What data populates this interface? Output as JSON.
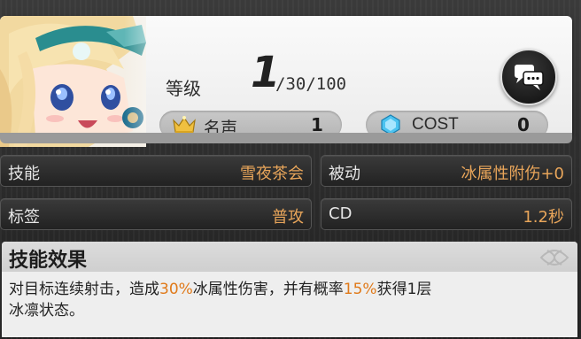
{
  "header": {
    "level_label": "等级",
    "level_value": "1",
    "level_max": "/30/100",
    "fame_label": "名声",
    "fame_value": "1",
    "cost_label": "COST",
    "cost_value": "0"
  },
  "stats": {
    "skill_label": "技能",
    "skill_value": "雪夜茶会",
    "passive_label": "被动",
    "passive_value": "冰属性附伤+0",
    "tag_label": "标签",
    "tag_value": "普攻",
    "cd_label": "CD",
    "cd_value": "1.2秒"
  },
  "effect": {
    "title": "技能效果",
    "text_1": "对目标连续射击，造成",
    "hl_1": "30%",
    "text_2": "冰属性伤害，并有概率",
    "hl_2": "15%",
    "text_3": "获得1层",
    "text_4": "冰凛状态。"
  },
  "colors": {
    "accent": "#e8a55a",
    "highlight": "#e07a1a"
  },
  "icons": [
    "crown-icon",
    "gem-icon",
    "chat-bubbles-icon"
  ]
}
